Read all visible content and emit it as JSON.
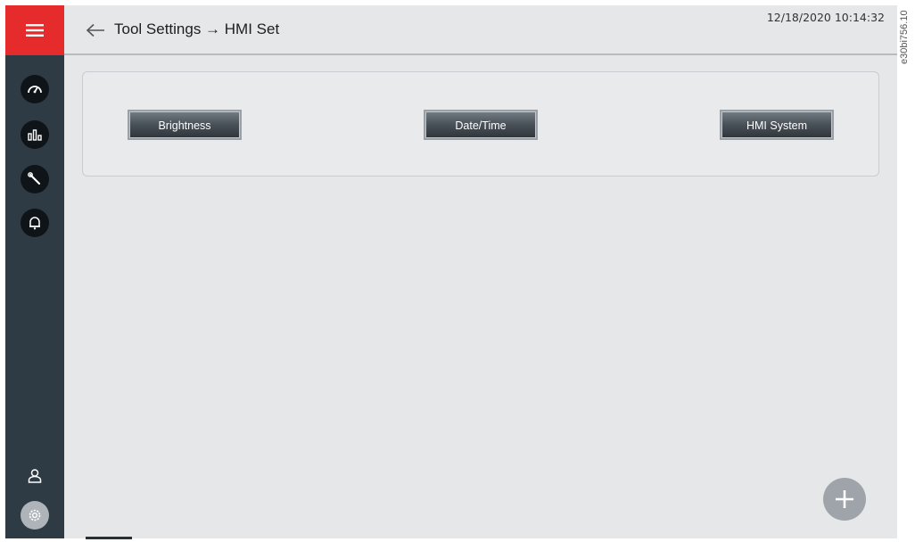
{
  "header": {
    "title": "Tool Settings → HMI Set",
    "datetime": "12/18/2020 10:14:32"
  },
  "panel": {
    "buttons": [
      {
        "label": "Brightness"
      },
      {
        "label": "Date/Time"
      },
      {
        "label": "HMI System"
      }
    ]
  },
  "rail": {
    "icons": [
      "menu-icon",
      "gauge-icon",
      "chart-icon",
      "wrench-icon",
      "bell-icon",
      "user-icon",
      "gear-icon"
    ]
  },
  "fab": {
    "icon": "plus-icon"
  },
  "watermark": "e30bi756.10",
  "colors": {
    "accent": "#e52b2b",
    "rail": "#2e3b45",
    "background": "#e6e7e9"
  }
}
